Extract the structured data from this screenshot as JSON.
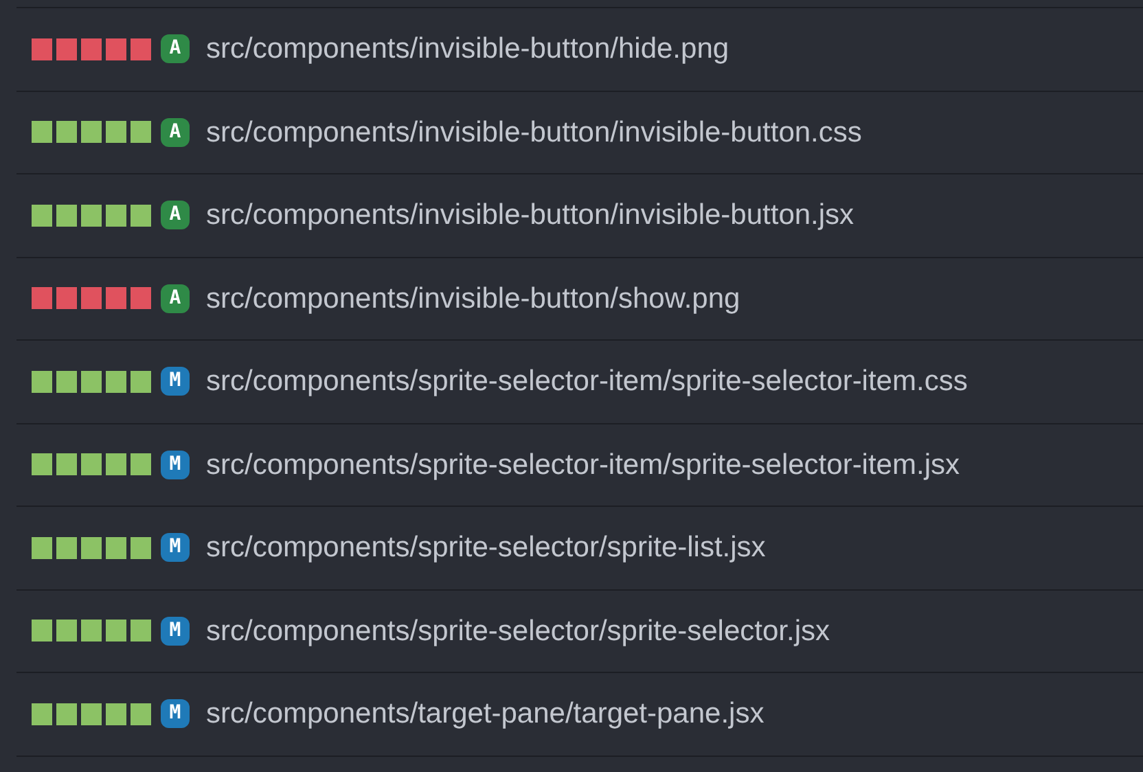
{
  "files": [
    {
      "color": "#e0525e",
      "status": {
        "letter": "A",
        "color": "#2f8a47"
      },
      "path": "src/components/invisible-button/hide.png"
    },
    {
      "color": "#8cc265",
      "status": {
        "letter": "A",
        "color": "#2f8a47"
      },
      "path": "src/components/invisible-button/invisible-button.css"
    },
    {
      "color": "#8cc265",
      "status": {
        "letter": "A",
        "color": "#2f8a47"
      },
      "path": "src/components/invisible-button/invisible-button.jsx"
    },
    {
      "color": "#e0525e",
      "status": {
        "letter": "A",
        "color": "#2f8a47"
      },
      "path": "src/components/invisible-button/show.png"
    },
    {
      "color": "#8cc265",
      "status": {
        "letter": "M",
        "color": "#1f7ab8"
      },
      "path": "src/components/sprite-selector-item/sprite-selector-item.css"
    },
    {
      "color": "#8cc265",
      "status": {
        "letter": "M",
        "color": "#1f7ab8"
      },
      "path": "src/components/sprite-selector-item/sprite-selector-item.jsx"
    },
    {
      "color": "#8cc265",
      "status": {
        "letter": "M",
        "color": "#1f7ab8"
      },
      "path": "src/components/sprite-selector/sprite-list.jsx"
    },
    {
      "color": "#8cc265",
      "status": {
        "letter": "M",
        "color": "#1f7ab8"
      },
      "path": "src/components/sprite-selector/sprite-selector.jsx"
    },
    {
      "color": "#8cc265",
      "status": {
        "letter": "M",
        "color": "#1f7ab8"
      },
      "path": "src/components/target-pane/target-pane.jsx"
    }
  ]
}
